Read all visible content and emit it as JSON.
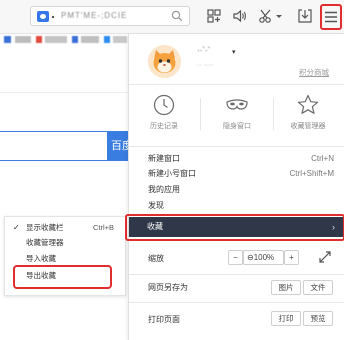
{
  "toolbar": {
    "address_text": "PMT'ME-;DCIE",
    "icons": [
      "site-icon",
      "search-icon",
      "apps-icon",
      "audio-icon",
      "screenshot-icon",
      "dropdown-arrow-icon",
      "download-icon",
      "menu-icon"
    ],
    "highlight_color": "#e02d2d"
  },
  "page": {
    "search_button_label": "百度"
  },
  "submenu": {
    "items": [
      {
        "label": "显示收藏栏",
        "shortcut": "Ctrl+B",
        "checked": true
      },
      {
        "label": "收藏管理器",
        "shortcut": "",
        "checked": false
      },
      {
        "label": "导入收藏",
        "shortcut": "",
        "checked": false
      },
      {
        "label": "导出收藏",
        "shortcut": "",
        "checked": false
      }
    ]
  },
  "menu": {
    "user": {
      "name": "··`·`",
      "caret": "▾",
      "sub": "·· ····",
      "points_link": "积分商城"
    },
    "quick_actions": [
      {
        "label": "历史记录",
        "icon": "clock-icon"
      },
      {
        "label": "隐身窗口",
        "icon": "mask-icon"
      },
      {
        "label": "收藏管理器",
        "icon": "star-icon"
      }
    ],
    "items": [
      {
        "label": "新建窗口",
        "shortcut": "Ctrl+N"
      },
      {
        "label": "新建小号窗口",
        "shortcut": "Ctrl+Shift+M"
      },
      {
        "label": "我的应用",
        "shortcut": ""
      },
      {
        "label": "发现",
        "shortcut": ""
      }
    ],
    "bookmarks": {
      "label": "收藏",
      "arrow": "›",
      "bg_color": "#2f3748"
    },
    "zoom": {
      "label": "缩放",
      "minus": "−",
      "value": "100%",
      "plus": "+",
      "zoom_glyph": "⊖"
    },
    "save_as": {
      "label": "网页另存为",
      "buttons": [
        "图片",
        "文件"
      ]
    },
    "print": {
      "label": "打印页面",
      "buttons": [
        "打印",
        "预览"
      ]
    }
  }
}
